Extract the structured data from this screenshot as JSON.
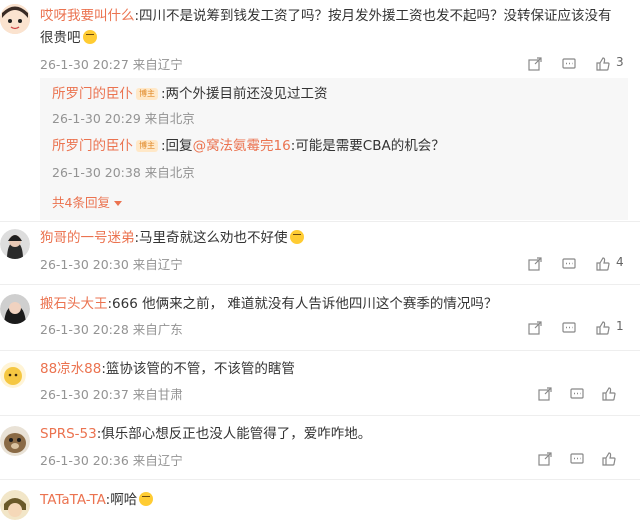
{
  "comments": [
    {
      "name": "哎呀我要叫什么",
      "text_line1": ":四川不是说筹到钱发工资了吗？按月发外援工资也发不起吗？没转保证应该没有",
      "text_line2": "很贵吧",
      "time": "26-1-30 20:27 来自辽宁",
      "like_count": "3",
      "replies": [
        {
          "name": "所罗门的臣仆",
          "badge": "博主",
          "text": ":两个外援目前还没见过工资",
          "time": "26-1-30 20:29 来自北京"
        },
        {
          "name": "所罗门的臣仆",
          "badge": "博主",
          "reply_prefix": ":回复",
          "mention": "@窝法氨霉完16",
          "text": ":可能是需要CBA的机会？",
          "time": "26-1-30 20:38 来自北京"
        }
      ],
      "more_label": "共4条回复"
    },
    {
      "name": "狗哥的一号迷弟",
      "text": ":马里奇就这么劝也不好使",
      "time": "26-1-30 20:30 来自辽宁",
      "like_count": "4"
    },
    {
      "name": "搬石头大王",
      "text": ":666 他俩来之前， 难道就没有人告诉他四川这个赛季的情况吗？",
      "time": "26-1-30 20:28 来自广东",
      "like_count": "1"
    },
    {
      "name": "88凉水88",
      "text": ":篮协该管的不管，不该管的瞎管",
      "time": "26-1-30 20:37 来自甘肃",
      "like_count": ""
    },
    {
      "name": "SPRS-53",
      "text": ":俱乐部心想反正也没人能管得了，爱咋咋地。",
      "time": "26-1-30 20:36 来自辽宁",
      "like_count": ""
    },
    {
      "name": "TATaTA-TA",
      "text": ":啊哈",
      "time": "",
      "like_count": ""
    }
  ],
  "icons": {
    "share": "share-icon",
    "comment": "comment-icon",
    "like": "thumbs-up-icon",
    "more": "chevron-down-icon"
  },
  "colors": {
    "name": "#eb7350",
    "meta": "#939393",
    "text": "#333333"
  }
}
